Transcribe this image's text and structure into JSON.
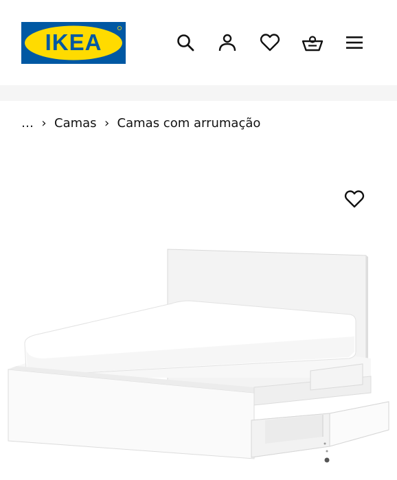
{
  "brand": {
    "logo_text": "IKEA",
    "colors": {
      "blue": "#0058a3",
      "yellow": "#ffdb00",
      "text": "#111111",
      "strip": "#f5f5f5"
    }
  },
  "header": {
    "icons": [
      "search-icon",
      "user-icon",
      "heart-icon",
      "shopping-basket-icon",
      "menu-icon"
    ]
  },
  "breadcrumb": {
    "items": [
      "…",
      "Camas",
      "Camas com arrumação"
    ],
    "separator": "›"
  },
  "product": {
    "favorite_icon": "heart-icon",
    "image_subject": "bed-with-storage-drawers"
  }
}
